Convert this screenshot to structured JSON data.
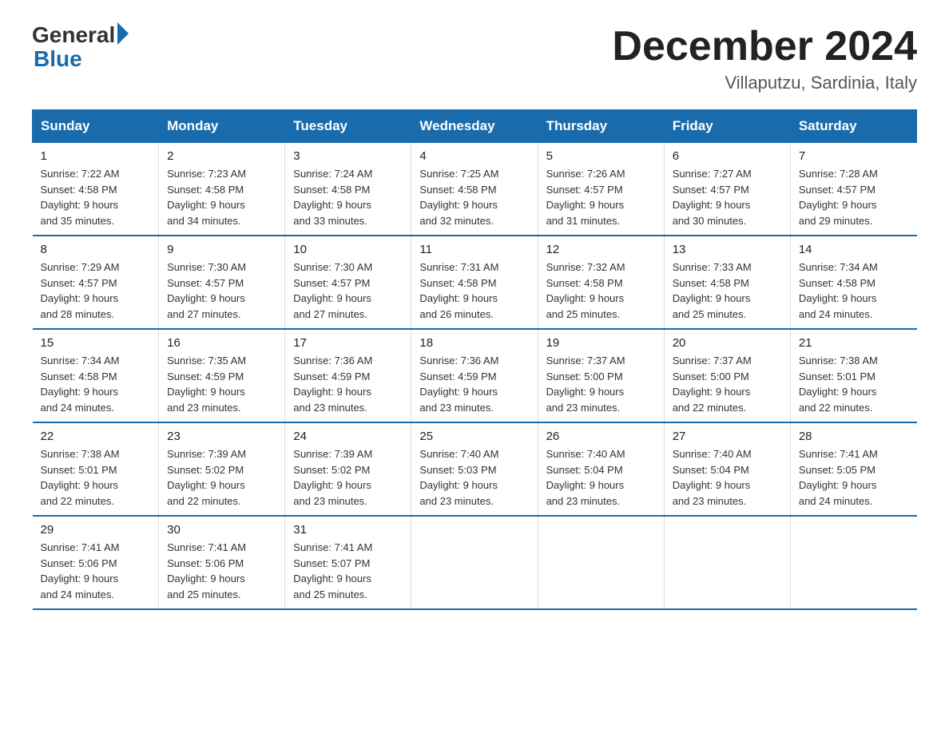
{
  "header": {
    "logo_general": "General",
    "logo_blue": "Blue",
    "month_title": "December 2024",
    "location": "Villaputzu, Sardinia, Italy"
  },
  "days_of_week": [
    "Sunday",
    "Monday",
    "Tuesday",
    "Wednesday",
    "Thursday",
    "Friday",
    "Saturday"
  ],
  "weeks": [
    [
      {
        "day": "1",
        "sunrise": "7:22 AM",
        "sunset": "4:58 PM",
        "daylight": "9 hours and 35 minutes."
      },
      {
        "day": "2",
        "sunrise": "7:23 AM",
        "sunset": "4:58 PM",
        "daylight": "9 hours and 34 minutes."
      },
      {
        "day": "3",
        "sunrise": "7:24 AM",
        "sunset": "4:58 PM",
        "daylight": "9 hours and 33 minutes."
      },
      {
        "day": "4",
        "sunrise": "7:25 AM",
        "sunset": "4:58 PM",
        "daylight": "9 hours and 32 minutes."
      },
      {
        "day": "5",
        "sunrise": "7:26 AM",
        "sunset": "4:57 PM",
        "daylight": "9 hours and 31 minutes."
      },
      {
        "day": "6",
        "sunrise": "7:27 AM",
        "sunset": "4:57 PM",
        "daylight": "9 hours and 30 minutes."
      },
      {
        "day": "7",
        "sunrise": "7:28 AM",
        "sunset": "4:57 PM",
        "daylight": "9 hours and 29 minutes."
      }
    ],
    [
      {
        "day": "8",
        "sunrise": "7:29 AM",
        "sunset": "4:57 PM",
        "daylight": "9 hours and 28 minutes."
      },
      {
        "day": "9",
        "sunrise": "7:30 AM",
        "sunset": "4:57 PM",
        "daylight": "9 hours and 27 minutes."
      },
      {
        "day": "10",
        "sunrise": "7:30 AM",
        "sunset": "4:57 PM",
        "daylight": "9 hours and 27 minutes."
      },
      {
        "day": "11",
        "sunrise": "7:31 AM",
        "sunset": "4:58 PM",
        "daylight": "9 hours and 26 minutes."
      },
      {
        "day": "12",
        "sunrise": "7:32 AM",
        "sunset": "4:58 PM",
        "daylight": "9 hours and 25 minutes."
      },
      {
        "day": "13",
        "sunrise": "7:33 AM",
        "sunset": "4:58 PM",
        "daylight": "9 hours and 25 minutes."
      },
      {
        "day": "14",
        "sunrise": "7:34 AM",
        "sunset": "4:58 PM",
        "daylight": "9 hours and 24 minutes."
      }
    ],
    [
      {
        "day": "15",
        "sunrise": "7:34 AM",
        "sunset": "4:58 PM",
        "daylight": "9 hours and 24 minutes."
      },
      {
        "day": "16",
        "sunrise": "7:35 AM",
        "sunset": "4:59 PM",
        "daylight": "9 hours and 23 minutes."
      },
      {
        "day": "17",
        "sunrise": "7:36 AM",
        "sunset": "4:59 PM",
        "daylight": "9 hours and 23 minutes."
      },
      {
        "day": "18",
        "sunrise": "7:36 AM",
        "sunset": "4:59 PM",
        "daylight": "9 hours and 23 minutes."
      },
      {
        "day": "19",
        "sunrise": "7:37 AM",
        "sunset": "5:00 PM",
        "daylight": "9 hours and 23 minutes."
      },
      {
        "day": "20",
        "sunrise": "7:37 AM",
        "sunset": "5:00 PM",
        "daylight": "9 hours and 22 minutes."
      },
      {
        "day": "21",
        "sunrise": "7:38 AM",
        "sunset": "5:01 PM",
        "daylight": "9 hours and 22 minutes."
      }
    ],
    [
      {
        "day": "22",
        "sunrise": "7:38 AM",
        "sunset": "5:01 PM",
        "daylight": "9 hours and 22 minutes."
      },
      {
        "day": "23",
        "sunrise": "7:39 AM",
        "sunset": "5:02 PM",
        "daylight": "9 hours and 22 minutes."
      },
      {
        "day": "24",
        "sunrise": "7:39 AM",
        "sunset": "5:02 PM",
        "daylight": "9 hours and 23 minutes."
      },
      {
        "day": "25",
        "sunrise": "7:40 AM",
        "sunset": "5:03 PM",
        "daylight": "9 hours and 23 minutes."
      },
      {
        "day": "26",
        "sunrise": "7:40 AM",
        "sunset": "5:04 PM",
        "daylight": "9 hours and 23 minutes."
      },
      {
        "day": "27",
        "sunrise": "7:40 AM",
        "sunset": "5:04 PM",
        "daylight": "9 hours and 23 minutes."
      },
      {
        "day": "28",
        "sunrise": "7:41 AM",
        "sunset": "5:05 PM",
        "daylight": "9 hours and 24 minutes."
      }
    ],
    [
      {
        "day": "29",
        "sunrise": "7:41 AM",
        "sunset": "5:06 PM",
        "daylight": "9 hours and 24 minutes."
      },
      {
        "day": "30",
        "sunrise": "7:41 AM",
        "sunset": "5:06 PM",
        "daylight": "9 hours and 25 minutes."
      },
      {
        "day": "31",
        "sunrise": "7:41 AM",
        "sunset": "5:07 PM",
        "daylight": "9 hours and 25 minutes."
      },
      null,
      null,
      null,
      null
    ]
  ],
  "labels": {
    "sunrise": "Sunrise:",
    "sunset": "Sunset:",
    "daylight": "Daylight:"
  }
}
